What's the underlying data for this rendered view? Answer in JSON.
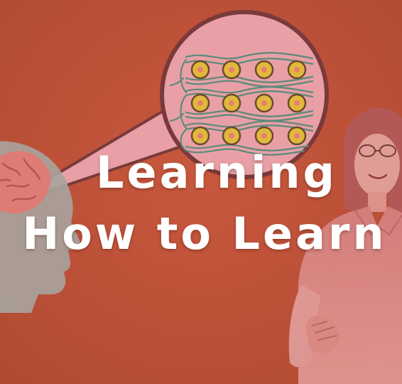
{
  "title": {
    "line1": "Learning",
    "line2": "How to Learn"
  },
  "colors": {
    "background": "#c1533a",
    "bubble_fill": "#e8a0a6",
    "bubble_border": "#7a3a3c",
    "head_silhouette": "#a8a39c",
    "brain": "#e07b74",
    "neuron_body": "#e0b83c",
    "neuron_core": "#e87f6e",
    "axon_lines": "#5b8a7a",
    "title_text": "#ffffff",
    "presenter_tint": "#d9797b"
  }
}
